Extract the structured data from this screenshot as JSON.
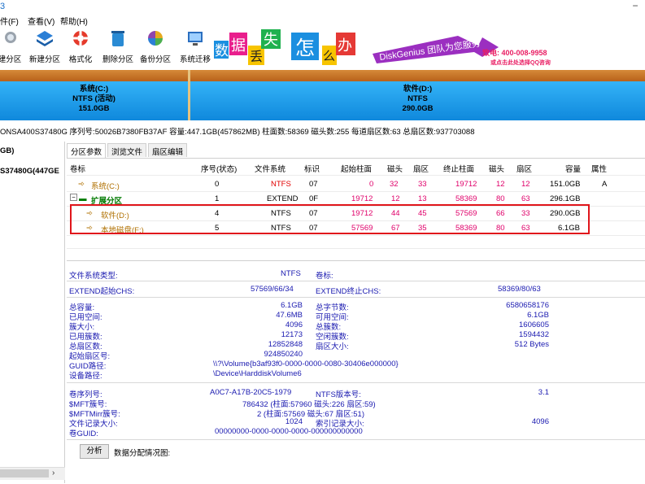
{
  "window": {
    "minimize": "−",
    "icon_glyph": "3"
  },
  "menu": [
    "件(F)",
    "查看(V)",
    "帮助(H)"
  ],
  "toolbar": [
    {
      "label": "建分区",
      "icon": "magnifier-icon"
    },
    {
      "label": "新建分区",
      "icon": "layers-icon"
    },
    {
      "label": "格式化",
      "icon": "lifebuoy-icon"
    },
    {
      "label": "删除分区",
      "icon": "trash-icon"
    },
    {
      "label": "备份分区",
      "icon": "backup-disk-icon"
    },
    {
      "label": "系统迁移",
      "icon": "monitor-migrate-icon"
    }
  ],
  "ad": {
    "chars": [
      "数",
      "据",
      "丢",
      "失",
      "怎",
      "么",
      "办"
    ],
    "brand": "DiskGenius 团队为您服务",
    "phone": "致电: 400-008-9958",
    "qq": "或点击此处选择QQ咨询"
  },
  "diskmap": {
    "c": {
      "line1": "系统(C:)",
      "line2": "NTFS (活动)",
      "line3": "151.0GB"
    },
    "d": {
      "line1": "软件(D:)",
      "line2": "NTFS",
      "line3": "290.0GB"
    }
  },
  "diskinfo": "ONSA400S37480G  序列号:50026B7380FB37AF  容量:447.1GB(457862MB)  柱面数:58369  磁头数:255  每道扇区数:63  总扇区数:937703088",
  "left": {
    "node1": "GB)",
    "node2": "S37480G(447GE"
  },
  "tabs": [
    "分区参数",
    "浏览文件",
    "扇区编辑"
  ],
  "table": {
    "headers": [
      "卷标",
      "序号(状态)",
      "文件系统",
      "标识",
      "起始柱面",
      "磁头",
      "扇区",
      "终止柱面",
      "磁头",
      "扇区",
      "容量",
      "属性"
    ],
    "rows": [
      {
        "name": "系统(C:)",
        "idx": "0",
        "fs": "NTFS",
        "id": "07",
        "sc": "0",
        "sh": "32",
        "ss": "33",
        "ec": "19712",
        "eh": "12",
        "es": "12",
        "cap": "151.0GB",
        "attr": "A"
      },
      {
        "name": "扩展分区",
        "idx": "1",
        "fs": "EXTEND",
        "id": "0F",
        "sc": "19712",
        "sh": "12",
        "ss": "13",
        "ec": "58369",
        "eh": "80",
        "es": "63",
        "cap": "296.1GB",
        "attr": ""
      },
      {
        "name": "软件(D:)",
        "idx": "4",
        "fs": "NTFS",
        "id": "07",
        "sc": "19712",
        "sh": "44",
        "ss": "45",
        "ec": "57569",
        "eh": "66",
        "es": "33",
        "cap": "290.0GB",
        "attr": ""
      },
      {
        "name": "本地磁盘(F:)",
        "idx": "5",
        "fs": "NTFS",
        "id": "07",
        "sc": "57569",
        "sh": "67",
        "ss": "35",
        "ec": "58369",
        "eh": "80",
        "es": "63",
        "cap": "6.1GB",
        "attr": ""
      }
    ]
  },
  "details": {
    "fs_type_label": "文件系统类型:",
    "fs_type": "NTFS",
    "vol_label": "卷标:",
    "ext_start_label": "EXTEND起始CHS:",
    "ext_start": "57569/66/34",
    "ext_end_label": "EXTEND终止CHS:",
    "ext_end": "58369/80/63",
    "total_cap_label": "总容量:",
    "total_cap": "6.1GB",
    "total_bytes_label": "总字节数:",
    "total_bytes": "6580658176",
    "used_label": "已用空间:",
    "used": "47.6MB",
    "free_label": "可用空间:",
    "free": "6.1GB",
    "cluster_label": "簇大小:",
    "cluster": "4096",
    "total_clusters_label": "总簇数:",
    "total_clusters": "1606605",
    "used_clusters_label": "已用簇数:",
    "used_clusters": "12173",
    "free_clusters_label": "空闲簇数:",
    "free_clusters": "1594432",
    "total_sectors_label": "总扇区数:",
    "total_sectors": "12852848",
    "sector_size_label": "扇区大小:",
    "sector_size": "512 Bytes",
    "start_sector_label": "起始扇区号:",
    "start_sector": "924850240",
    "guid_path_label": "GUID路径:",
    "guid_path": "\\\\?\\Volume{b3af93f0-0000-0000-0080-30406e000000}",
    "device_path_label": "设备路径:",
    "device_path": "\\Device\\HarddiskVolume6",
    "serial_label": "卷序列号:",
    "serial": "A0C7-A17B-20C5-1979",
    "ntfs_ver_label": "NTFS版本号:",
    "ntfs_ver": "3.1",
    "mft_label": "$MFT簇号:",
    "mft": "786432 (柱面:57960 磁头:226 扇区:59)",
    "mftmirr_label": "$MFTMirr簇号:",
    "mftmirr": "2 (柱面:57569 磁头:67 扇区:51)",
    "rec_size_label": "文件记录大小:",
    "rec_size": "1024",
    "idx_size_label": "索引记录大小:",
    "idx_size": "4096",
    "vol_guid_label": "卷GUID:",
    "vol_guid": "00000000-0000-0000-0000-000000000000"
  },
  "analyze": {
    "button": "分析",
    "label": "数据分配情况图:"
  },
  "scroll": {
    "right_arrow": "›"
  }
}
